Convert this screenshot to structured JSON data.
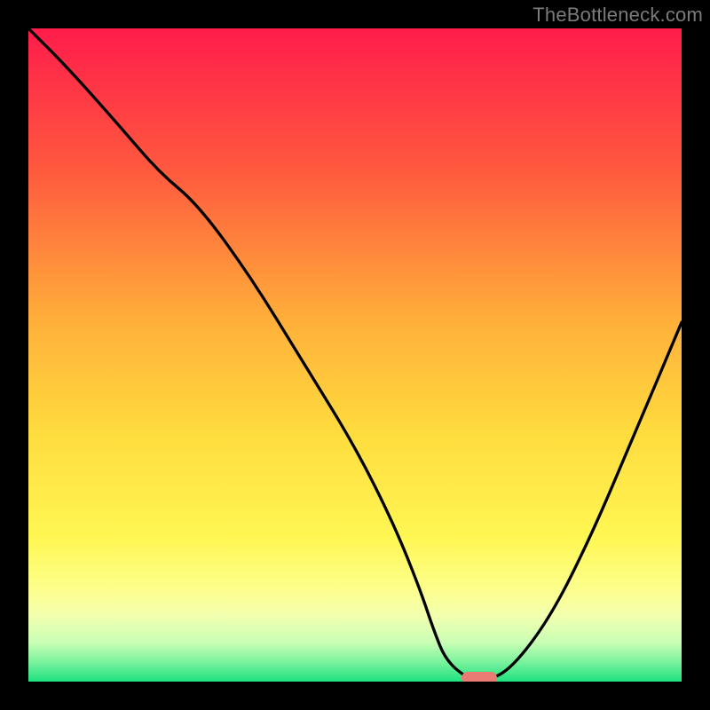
{
  "watermark": "TheBottleneck.com",
  "colors": {
    "frame": "#000000",
    "curve": "#000000",
    "marker": "#e97a74",
    "grad_stops": [
      {
        "pct": 0,
        "c": "#ff1c4b"
      },
      {
        "pct": 22,
        "c": "#ff5a3e"
      },
      {
        "pct": 45,
        "c": "#ffb03a"
      },
      {
        "pct": 62,
        "c": "#ffdc3e"
      },
      {
        "pct": 78,
        "c": "#fff753"
      },
      {
        "pct": 86,
        "c": "#fdff8d"
      },
      {
        "pct": 90,
        "c": "#f2ffb0"
      },
      {
        "pct": 94,
        "c": "#c9ffb4"
      },
      {
        "pct": 97,
        "c": "#7af29d"
      },
      {
        "pct": 100,
        "c": "#1ee27f"
      }
    ]
  },
  "chart_data": {
    "type": "line",
    "title": "",
    "xlabel": "",
    "ylabel": "",
    "xlim": [
      0,
      100
    ],
    "ylim": [
      0,
      100
    ],
    "series": [
      {
        "name": "bottleneck-curve",
        "x": [
          0,
          6,
          14,
          20,
          26,
          34,
          42,
          50,
          56,
          60,
          62,
          64,
          68,
          70,
          74,
          80,
          86,
          92,
          100
        ],
        "y": [
          100,
          94,
          85,
          78,
          73,
          62,
          49,
          36,
          24,
          14,
          8,
          3,
          0,
          0,
          2,
          10,
          22,
          36,
          55
        ]
      }
    ],
    "marker": {
      "x": 69,
      "y": 0.5
    }
  }
}
